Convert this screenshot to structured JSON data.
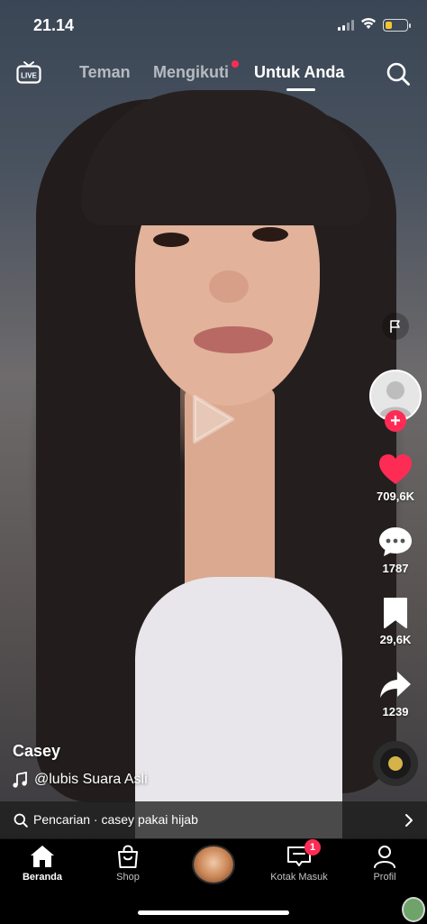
{
  "status_bar": {
    "time": "21.14",
    "battery_level": 0.35,
    "battery_color": "#f4c430"
  },
  "top_nav": {
    "live_label": "LIVE",
    "tabs": [
      {
        "label": "Teman",
        "active": false
      },
      {
        "label": "Mengikuti",
        "active": false,
        "has_dot": true
      },
      {
        "label": "Untuk Anda",
        "active": true
      }
    ],
    "search_icon": "search-icon"
  },
  "video": {
    "state": "paused",
    "play_icon": "play-icon"
  },
  "right_rail": {
    "flag_icon": "flag-icon",
    "avatar_icon": "default-avatar-icon",
    "follow_icon": "plus-icon",
    "like_count": "709,6K",
    "comment_count": "1787",
    "bookmark_count": "29,6K",
    "share_count": "1239",
    "accent_color": "#fe2c55"
  },
  "caption": {
    "username": "Casey",
    "sound": "@lubis Suara Asli"
  },
  "search_suggestion": {
    "text": "Pencarian · casey pakai hijab"
  },
  "bottom_nav": {
    "items": [
      {
        "label": "Beranda",
        "icon": "home-icon",
        "active": true
      },
      {
        "label": "Shop",
        "icon": "shopping-bag-icon",
        "active": false
      },
      {
        "label": "",
        "icon": "create-avatar-icon",
        "active": false
      },
      {
        "label": "Kotak Masuk",
        "icon": "inbox-icon",
        "active": false,
        "badge": "1"
      },
      {
        "label": "Profil",
        "icon": "profile-icon",
        "active": false
      }
    ]
  }
}
